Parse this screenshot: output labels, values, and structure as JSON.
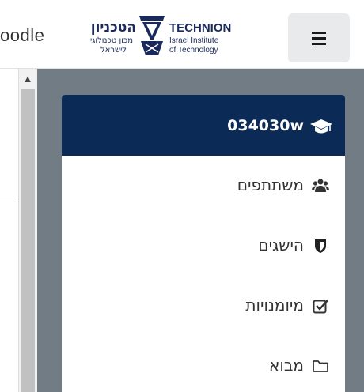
{
  "header": {
    "app_name": "oodle",
    "logo": {
      "hebrew_title": "הטכניון",
      "hebrew_sub1": "מכון טכנולוגי",
      "hebrew_sub2": "לישראל",
      "english_title": "TECHNION",
      "english_sub1": "Israel Institute",
      "english_sub2": "of Technology"
    },
    "menu_icon": "hamburger-icon"
  },
  "drawer": {
    "course_code": "034030w",
    "course_icon": "graduation-cap-icon",
    "items": [
      {
        "label": "משתתפים",
        "icon": "users-icon"
      },
      {
        "label": "הישגים",
        "icon": "shield-icon"
      },
      {
        "label": "מיומנויות",
        "icon": "checkbox-icon"
      },
      {
        "label": "מבוא",
        "icon": "folder-icon"
      }
    ]
  },
  "colors": {
    "course_header": "#0b2a55",
    "backdrop": "#727c84",
    "logo_navy": "#1a2a5c"
  }
}
